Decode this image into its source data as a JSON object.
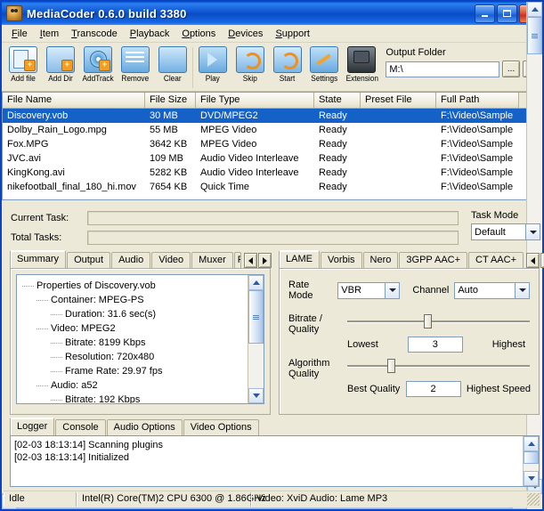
{
  "window": {
    "title": "MediaCoder 0.6.0 build 3380",
    "icon": "app-icon",
    "minimize": "_",
    "maximize": "□",
    "close": "✕"
  },
  "menu": {
    "items": [
      {
        "label": "File"
      },
      {
        "label": "Item"
      },
      {
        "label": "Transcode"
      },
      {
        "label": "Playback"
      },
      {
        "label": "Options"
      },
      {
        "label": "Devices"
      },
      {
        "label": "Support"
      }
    ]
  },
  "toolbar": {
    "buttons": [
      {
        "label": "Add file",
        "icon": "add-file-icon"
      },
      {
        "label": "Add Dir",
        "icon": "add-dir-icon"
      },
      {
        "label": "AddTrack",
        "icon": "add-track-icon"
      },
      {
        "label": "Remove",
        "icon": "remove-icon"
      },
      {
        "label": "Clear",
        "icon": "clear-icon"
      },
      {
        "label": "Play",
        "icon": "play-icon"
      },
      {
        "label": "Skip",
        "icon": "skip-icon"
      },
      {
        "label": "Start",
        "icon": "start-icon"
      },
      {
        "label": "Settings",
        "icon": "settings-icon"
      },
      {
        "label": "Extension",
        "icon": "extension-icon"
      }
    ]
  },
  "output_folder": {
    "label": "Output Folder",
    "value": "M:\\",
    "placeholder": "",
    "browse_button": "...",
    "open_button": "O"
  },
  "file_list": {
    "columns": [
      "File Name",
      "File Size",
      "File Type",
      "State",
      "Preset File",
      "Full Path"
    ],
    "rows": [
      {
        "name": "Discovery.vob",
        "size": "30 MB",
        "type": "DVD/MPEG2",
        "state": "Ready",
        "preset": "",
        "path": "F:\\Video\\Sample",
        "selected": true
      },
      {
        "name": "Dolby_Rain_Logo.mpg",
        "size": "55 MB",
        "type": "MPEG Video",
        "state": "Ready",
        "preset": "",
        "path": "F:\\Video\\Sample",
        "selected": false
      },
      {
        "name": "Fox.MPG",
        "size": "3642 KB",
        "type": "MPEG Video",
        "state": "Ready",
        "preset": "",
        "path": "F:\\Video\\Sample",
        "selected": false
      },
      {
        "name": "JVC.avi",
        "size": "109 MB",
        "type": "Audio Video Interleave",
        "state": "Ready",
        "preset": "",
        "path": "F:\\Video\\Sample",
        "selected": false
      },
      {
        "name": "KingKong.avi",
        "size": "5282 KB",
        "type": "Audio Video Interleave",
        "state": "Ready",
        "preset": "",
        "path": "F:\\Video\\Sample",
        "selected": false
      },
      {
        "name": "nikefootball_final_180_hi.mov",
        "size": "7654 KB",
        "type": "Quick Time",
        "state": "Ready",
        "preset": "",
        "path": "F:\\Video\\Sample",
        "selected": false
      }
    ]
  },
  "tasks": {
    "current_label": "Current Task:",
    "total_label": "Total Tasks:",
    "current_progress": 0,
    "total_progress": 0,
    "task_mode_label": "Task Mode",
    "task_mode_value": "Default"
  },
  "left_tabs": {
    "items": [
      {
        "label": "Summary",
        "active": true
      },
      {
        "label": "Output",
        "active": false
      },
      {
        "label": "Audio",
        "active": false
      },
      {
        "label": "Video",
        "active": false
      },
      {
        "label": "Muxer",
        "active": false
      },
      {
        "label": "Pict",
        "active": false
      }
    ],
    "scroll_left": "◀",
    "scroll_right": "▶"
  },
  "summary": {
    "nodes": [
      {
        "text": "Properties of Discovery.vob",
        "depth": 0
      },
      {
        "text": "Container: MPEG-PS",
        "depth": 1
      },
      {
        "text": "Duration: 31.6 sec(s)",
        "depth": 2
      },
      {
        "text": "Video: MPEG2",
        "depth": 1
      },
      {
        "text": "Bitrate: 8199 Kbps",
        "depth": 2
      },
      {
        "text": "Resolution: 720x480",
        "depth": 2
      },
      {
        "text": "Frame Rate: 29.97 fps",
        "depth": 2
      },
      {
        "text": "Audio: a52",
        "depth": 1
      },
      {
        "text": "Bitrate: 192 Kbps",
        "depth": 2
      }
    ]
  },
  "right_tabs": {
    "items": [
      {
        "label": "LAME",
        "active": true
      },
      {
        "label": "Vorbis",
        "active": false
      },
      {
        "label": "Nero",
        "active": false
      },
      {
        "label": "3GPP AAC+",
        "active": false
      },
      {
        "label": "CT AAC+",
        "active": false
      }
    ],
    "scroll_left": "◀",
    "scroll_right": "▶"
  },
  "lame": {
    "rate_mode_label": "Rate Mode",
    "rate_mode_value": "VBR",
    "channel_label": "Channel",
    "channel_value": "Auto",
    "bitrate_quality_label": "Bitrate / Quality",
    "bitrate_quality_value": "3",
    "bitrate_min_label": "Lowest",
    "bitrate_max_label": "Highest",
    "bitrate_slider_pct": 42,
    "algorithm_quality_label": "Algorithm Quality",
    "algorithm_quality_value": "2",
    "algorithm_min_label": "Best Quality",
    "algorithm_max_label": "Highest Speed",
    "algorithm_slider_pct": 22
  },
  "logger": {
    "tabs": [
      {
        "label": "Logger",
        "active": true
      },
      {
        "label": "Console",
        "active": false
      },
      {
        "label": "Audio Options",
        "active": false
      },
      {
        "label": "Video Options",
        "active": false
      }
    ],
    "lines": [
      "[02-03 18:13:14] Scanning plugins",
      "[02-03 18:13:14] Initialized"
    ]
  },
  "status_bar": {
    "state": "Idle",
    "cpu": "Intel(R) Core(TM)2 CPU 6300 @ 1.86GHz",
    "codecs": "Video: XviD Audio: Lame MP3"
  }
}
